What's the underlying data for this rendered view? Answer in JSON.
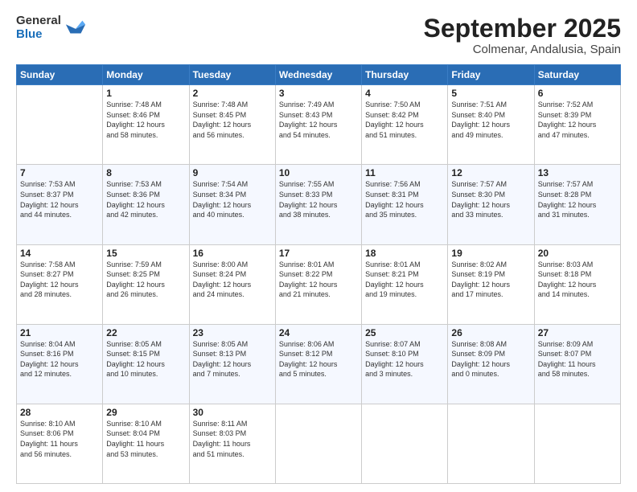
{
  "logo": {
    "general": "General",
    "blue": "Blue"
  },
  "title": "September 2025",
  "subtitle": "Colmenar, Andalusia, Spain",
  "days_of_week": [
    "Sunday",
    "Monday",
    "Tuesday",
    "Wednesday",
    "Thursday",
    "Friday",
    "Saturday"
  ],
  "weeks": [
    [
      {
        "num": "",
        "info": ""
      },
      {
        "num": "1",
        "info": "Sunrise: 7:48 AM\nSunset: 8:46 PM\nDaylight: 12 hours\nand 58 minutes."
      },
      {
        "num": "2",
        "info": "Sunrise: 7:48 AM\nSunset: 8:45 PM\nDaylight: 12 hours\nand 56 minutes."
      },
      {
        "num": "3",
        "info": "Sunrise: 7:49 AM\nSunset: 8:43 PM\nDaylight: 12 hours\nand 54 minutes."
      },
      {
        "num": "4",
        "info": "Sunrise: 7:50 AM\nSunset: 8:42 PM\nDaylight: 12 hours\nand 51 minutes."
      },
      {
        "num": "5",
        "info": "Sunrise: 7:51 AM\nSunset: 8:40 PM\nDaylight: 12 hours\nand 49 minutes."
      },
      {
        "num": "6",
        "info": "Sunrise: 7:52 AM\nSunset: 8:39 PM\nDaylight: 12 hours\nand 47 minutes."
      }
    ],
    [
      {
        "num": "7",
        "info": "Sunrise: 7:53 AM\nSunset: 8:37 PM\nDaylight: 12 hours\nand 44 minutes."
      },
      {
        "num": "8",
        "info": "Sunrise: 7:53 AM\nSunset: 8:36 PM\nDaylight: 12 hours\nand 42 minutes."
      },
      {
        "num": "9",
        "info": "Sunrise: 7:54 AM\nSunset: 8:34 PM\nDaylight: 12 hours\nand 40 minutes."
      },
      {
        "num": "10",
        "info": "Sunrise: 7:55 AM\nSunset: 8:33 PM\nDaylight: 12 hours\nand 38 minutes."
      },
      {
        "num": "11",
        "info": "Sunrise: 7:56 AM\nSunset: 8:31 PM\nDaylight: 12 hours\nand 35 minutes."
      },
      {
        "num": "12",
        "info": "Sunrise: 7:57 AM\nSunset: 8:30 PM\nDaylight: 12 hours\nand 33 minutes."
      },
      {
        "num": "13",
        "info": "Sunrise: 7:57 AM\nSunset: 8:28 PM\nDaylight: 12 hours\nand 31 minutes."
      }
    ],
    [
      {
        "num": "14",
        "info": "Sunrise: 7:58 AM\nSunset: 8:27 PM\nDaylight: 12 hours\nand 28 minutes."
      },
      {
        "num": "15",
        "info": "Sunrise: 7:59 AM\nSunset: 8:25 PM\nDaylight: 12 hours\nand 26 minutes."
      },
      {
        "num": "16",
        "info": "Sunrise: 8:00 AM\nSunset: 8:24 PM\nDaylight: 12 hours\nand 24 minutes."
      },
      {
        "num": "17",
        "info": "Sunrise: 8:01 AM\nSunset: 8:22 PM\nDaylight: 12 hours\nand 21 minutes."
      },
      {
        "num": "18",
        "info": "Sunrise: 8:01 AM\nSunset: 8:21 PM\nDaylight: 12 hours\nand 19 minutes."
      },
      {
        "num": "19",
        "info": "Sunrise: 8:02 AM\nSunset: 8:19 PM\nDaylight: 12 hours\nand 17 minutes."
      },
      {
        "num": "20",
        "info": "Sunrise: 8:03 AM\nSunset: 8:18 PM\nDaylight: 12 hours\nand 14 minutes."
      }
    ],
    [
      {
        "num": "21",
        "info": "Sunrise: 8:04 AM\nSunset: 8:16 PM\nDaylight: 12 hours\nand 12 minutes."
      },
      {
        "num": "22",
        "info": "Sunrise: 8:05 AM\nSunset: 8:15 PM\nDaylight: 12 hours\nand 10 minutes."
      },
      {
        "num": "23",
        "info": "Sunrise: 8:05 AM\nSunset: 8:13 PM\nDaylight: 12 hours\nand 7 minutes."
      },
      {
        "num": "24",
        "info": "Sunrise: 8:06 AM\nSunset: 8:12 PM\nDaylight: 12 hours\nand 5 minutes."
      },
      {
        "num": "25",
        "info": "Sunrise: 8:07 AM\nSunset: 8:10 PM\nDaylight: 12 hours\nand 3 minutes."
      },
      {
        "num": "26",
        "info": "Sunrise: 8:08 AM\nSunset: 8:09 PM\nDaylight: 12 hours\nand 0 minutes."
      },
      {
        "num": "27",
        "info": "Sunrise: 8:09 AM\nSunset: 8:07 PM\nDaylight: 11 hours\nand 58 minutes."
      }
    ],
    [
      {
        "num": "28",
        "info": "Sunrise: 8:10 AM\nSunset: 8:06 PM\nDaylight: 11 hours\nand 56 minutes."
      },
      {
        "num": "29",
        "info": "Sunrise: 8:10 AM\nSunset: 8:04 PM\nDaylight: 11 hours\nand 53 minutes."
      },
      {
        "num": "30",
        "info": "Sunrise: 8:11 AM\nSunset: 8:03 PM\nDaylight: 11 hours\nand 51 minutes."
      },
      {
        "num": "",
        "info": ""
      },
      {
        "num": "",
        "info": ""
      },
      {
        "num": "",
        "info": ""
      },
      {
        "num": "",
        "info": ""
      }
    ]
  ]
}
